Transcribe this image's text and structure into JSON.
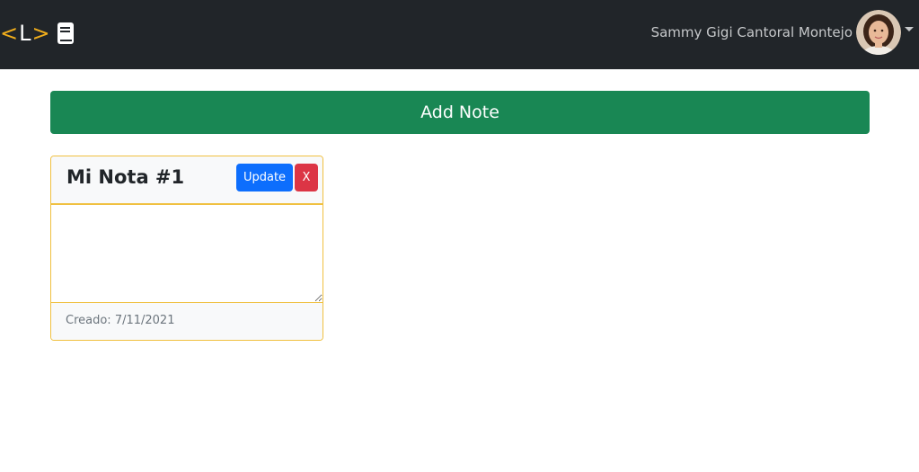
{
  "navbar": {
    "brand": {
      "open": "<",
      "letter": "L",
      "close": ">",
      "icon": "notebook-icon"
    },
    "user": {
      "name": "Sammy Gigi Cantoral Montejo",
      "avatar_icon": "user-avatar",
      "menu_icon": "caret-down-icon"
    }
  },
  "main": {
    "add_note_label": "Add Note",
    "notes": [
      {
        "title": "Mi Nota #1",
        "update_label": "Update",
        "delete_label": "X",
        "content": "",
        "footer": "Creado: 7/11/2021"
      }
    ]
  },
  "colors": {
    "navbar_bg": "#212529",
    "brand_accent": "#f0ad1c",
    "add_button": "#198754",
    "update_button": "#0d6efd",
    "delete_button": "#dc3545",
    "card_border": "#f0c040"
  }
}
